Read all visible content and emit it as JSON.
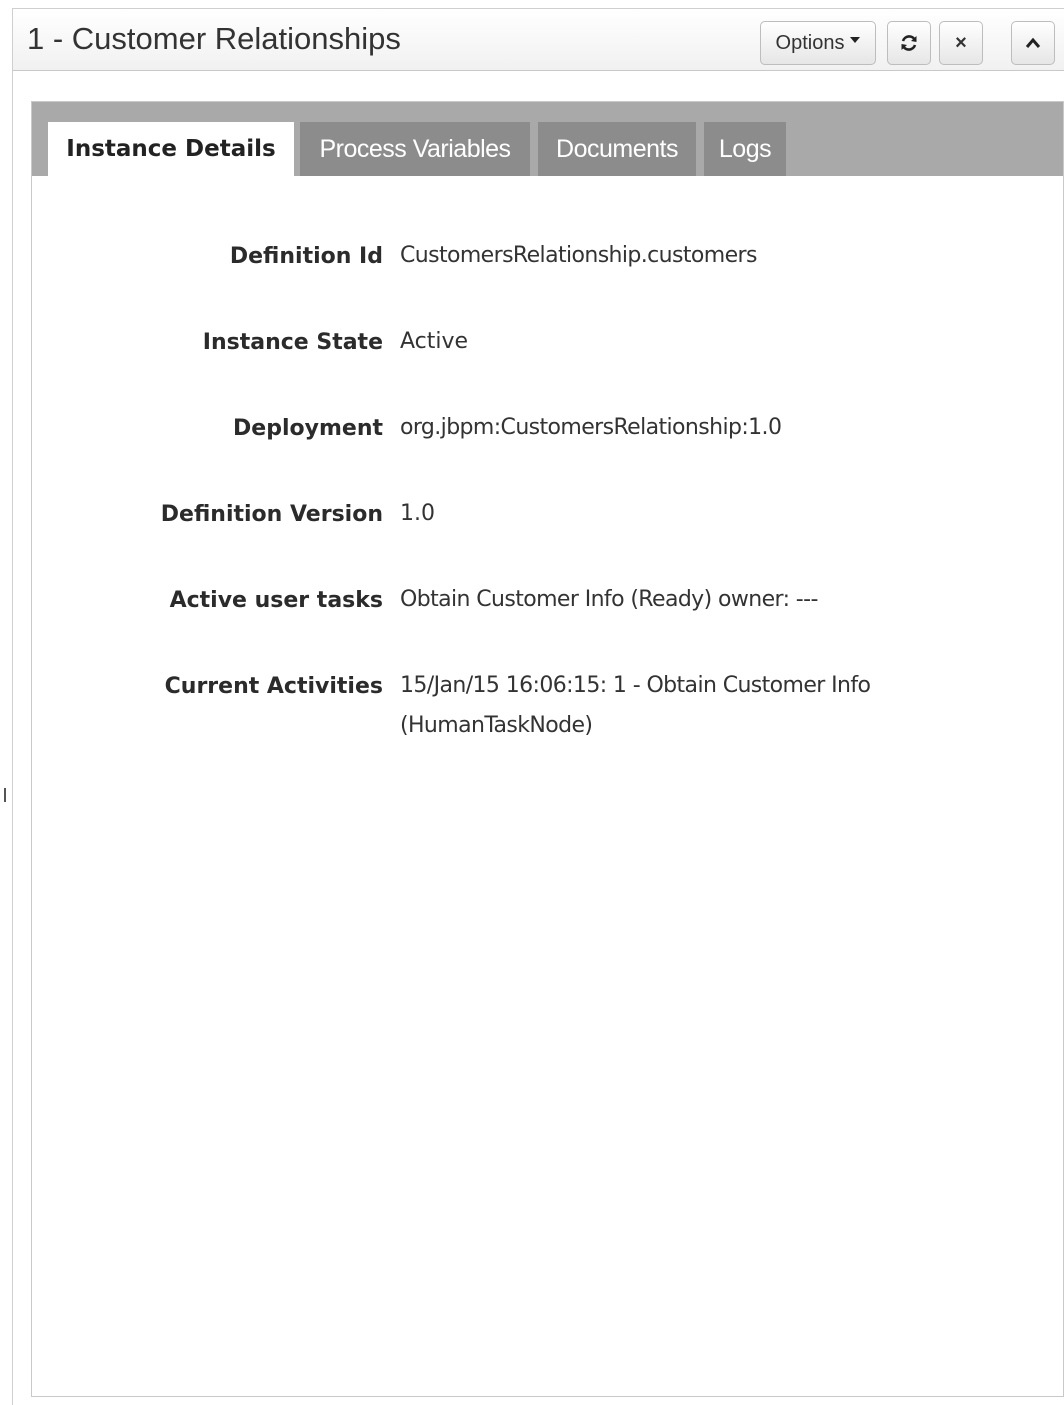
{
  "panel": {
    "title": "1 - Customer Relationships",
    "options_label": "Options",
    "icons": {
      "refresh": "refresh-icon",
      "close": "close-icon",
      "collapse": "chevron-up-icon"
    },
    "close_glyph": "×"
  },
  "tabs": [
    {
      "label": "Instance Details",
      "active": true
    },
    {
      "label": "Process Variables",
      "active": false
    },
    {
      "label": "Documents",
      "active": false
    },
    {
      "label": "Logs",
      "active": false
    }
  ],
  "details": [
    {
      "label": "Definition Id",
      "value": "CustomersRelationship.customers"
    },
    {
      "label": "Instance State",
      "value": "Active"
    },
    {
      "label": "Deployment",
      "value": "org.jbpm:CustomersRelationship:1.0"
    },
    {
      "label": "Definition Version",
      "value": "1.0"
    },
    {
      "label": "Active user tasks",
      "value": "Obtain Customer Info (Ready) owner: ---"
    },
    {
      "label": "Current Activities",
      "value_line1": "15/Jan/15 16:06:15: 1 - Obtain Customer Info",
      "value_line2": "(HumanTaskNode)"
    }
  ],
  "colors": {
    "tabbar": "#a9a9a9",
    "inactive_tab": "#8c8c8c",
    "active_tab": "#ffffff"
  }
}
